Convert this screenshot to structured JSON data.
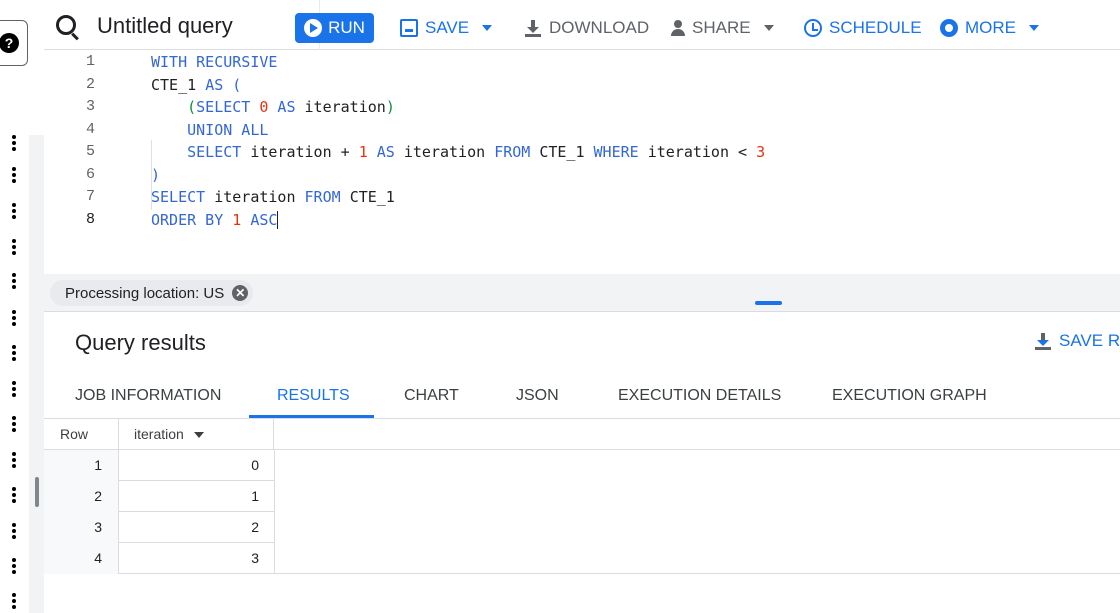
{
  "toolbar": {
    "title": "Untitled query",
    "run_label": "RUN",
    "save_label": "SAVE",
    "download_label": "DOWNLOAD",
    "share_label": "SHARE",
    "schedule_label": "SCHEDULE",
    "more_label": "MORE"
  },
  "rail": {
    "help_glyph": "?"
  },
  "editor": {
    "line_numbers": [
      "1",
      "2",
      "3",
      "4",
      "5",
      "6",
      "7",
      "8"
    ],
    "active_line": "8",
    "lines": [
      [
        {
          "t": "WITH RECURSIVE",
          "c": "kw"
        }
      ],
      [
        {
          "t": "CTE_1 ",
          "c": "id"
        },
        {
          "t": "AS (",
          "c": "kw"
        }
      ],
      [
        {
          "t": "    ",
          "c": "id"
        },
        {
          "t": "(",
          "c": "paren"
        },
        {
          "t": "SELECT ",
          "c": "kw"
        },
        {
          "t": "0",
          "c": "num"
        },
        {
          "t": " AS ",
          "c": "kw"
        },
        {
          "t": "iteration",
          "c": "id"
        },
        {
          "t": ")",
          "c": "paren"
        }
      ],
      [
        {
          "t": "    ",
          "c": "id"
        },
        {
          "t": "UNION ALL",
          "c": "kw"
        }
      ],
      [
        {
          "t": "    ",
          "c": "id"
        },
        {
          "t": "SELECT ",
          "c": "kw"
        },
        {
          "t": "iteration + ",
          "c": "id"
        },
        {
          "t": "1",
          "c": "num"
        },
        {
          "t": " AS ",
          "c": "kw"
        },
        {
          "t": "iteration ",
          "c": "id"
        },
        {
          "t": "FROM ",
          "c": "kw"
        },
        {
          "t": "CTE_1 ",
          "c": "id"
        },
        {
          "t": "WHERE ",
          "c": "kw"
        },
        {
          "t": "iteration < ",
          "c": "id"
        },
        {
          "t": "3",
          "c": "num"
        }
      ],
      [
        {
          "t": ")",
          "c": "kw"
        }
      ],
      [
        {
          "t": "SELECT ",
          "c": "kw"
        },
        {
          "t": "iteration ",
          "c": "id"
        },
        {
          "t": "FROM ",
          "c": "kw"
        },
        {
          "t": "CTE_1",
          "c": "id"
        }
      ],
      [
        {
          "t": "ORDER BY ",
          "c": "kw"
        },
        {
          "t": "1",
          "c": "num"
        },
        {
          "t": " ASC",
          "c": "kw"
        }
      ]
    ]
  },
  "processing": {
    "label": "Processing location: US",
    "close_glyph": "✕"
  },
  "results": {
    "title": "Query results",
    "save_label": "SAVE RE",
    "tabs": [
      {
        "label": "JOB INFORMATION",
        "active": false
      },
      {
        "label": "RESULTS",
        "active": true
      },
      {
        "label": "CHART",
        "active": false
      },
      {
        "label": "JSON",
        "active": false
      },
      {
        "label": "EXECUTION DETAILS",
        "active": false
      },
      {
        "label": "EXECUTION GRAPH",
        "active": false
      }
    ],
    "columns": [
      "Row",
      "iteration"
    ],
    "rows": [
      [
        "1",
        "0"
      ],
      [
        "2",
        "1"
      ],
      [
        "3",
        "2"
      ],
      [
        "4",
        "3"
      ]
    ]
  },
  "colors": {
    "accent": "#1a73e8",
    "keyword": "#3367d6",
    "number": "#e8340e",
    "paren": "#0d8f3a"
  }
}
